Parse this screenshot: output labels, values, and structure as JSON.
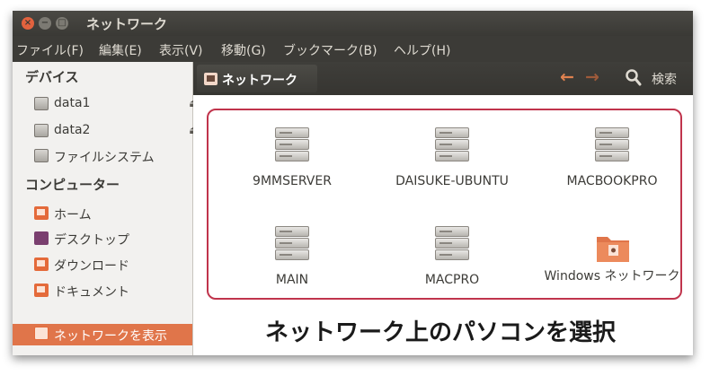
{
  "window": {
    "title": "ネットワーク",
    "buttons": {
      "close": "×",
      "minimize": "−",
      "maximize": "□"
    }
  },
  "menu": [
    "ファイル(F)",
    "編集(E)",
    "表示(V)",
    "移動(G)",
    "ブックマーク(B)",
    "ヘルプ(H)"
  ],
  "sidebar": {
    "devices_header": "デバイス",
    "devices": [
      {
        "label": "data1",
        "icon": "drive-icon",
        "eject": "⏏"
      },
      {
        "label": "data2",
        "icon": "drive-icon",
        "eject": "⏏"
      },
      {
        "label": "ファイルシステム",
        "icon": "drive-icon"
      }
    ],
    "computer_header": "コンピューター",
    "places": [
      {
        "label": "ホーム",
        "icon": "home-folder-icon"
      },
      {
        "label": "デスクトップ",
        "icon": "desktop-icon"
      },
      {
        "label": "ダウンロード",
        "icon": "downloads-folder-icon"
      },
      {
        "label": "ドキュメント",
        "icon": "documents-folder-icon"
      }
    ],
    "network": {
      "label": "ネットワークを表示",
      "icon": "network-icon"
    }
  },
  "toolbar": {
    "location": "ネットワーク",
    "back": "←",
    "forward": "→",
    "search_label": "検索"
  },
  "network_items": [
    {
      "name": "9MMSERVER",
      "icon": "server-icon"
    },
    {
      "name": "DAISUKE-UBUNTU",
      "icon": "server-icon"
    },
    {
      "name": "MACBOOKPRO",
      "icon": "server-icon"
    },
    {
      "name": "MAIN",
      "icon": "server-icon"
    },
    {
      "name": "MACPRO",
      "icon": "server-icon"
    },
    {
      "name": "Windows ネットワーク",
      "icon": "windows-network-folder-icon"
    }
  ],
  "caption": "ネットワーク上のパソコンを選択",
  "colors": {
    "accent": "#e0754a",
    "highlight_border": "#c0344c",
    "titlebar": "#3c3b37"
  }
}
